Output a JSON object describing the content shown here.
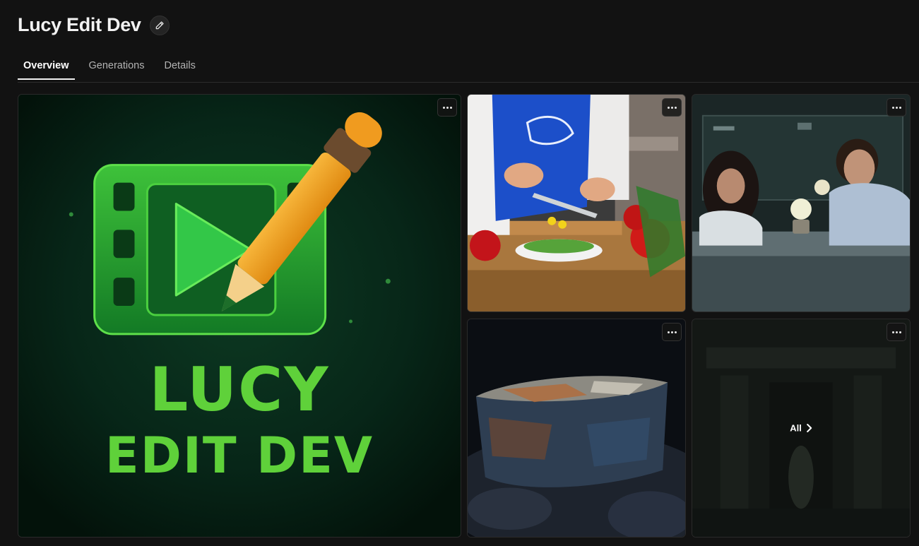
{
  "header": {
    "title": "Lucy Edit Dev"
  },
  "tabs": [
    {
      "label": "Overview",
      "active": true
    },
    {
      "label": "Generations",
      "active": false
    },
    {
      "label": "Details",
      "active": false
    }
  ],
  "gallery": {
    "hero": {
      "line1": "LUCY",
      "line2": "EDIT DEV"
    },
    "all_label": "All"
  },
  "colors": {
    "background": "#121212",
    "accent_green": "#5fd13a",
    "pencil_orange": "#f4a32a"
  }
}
